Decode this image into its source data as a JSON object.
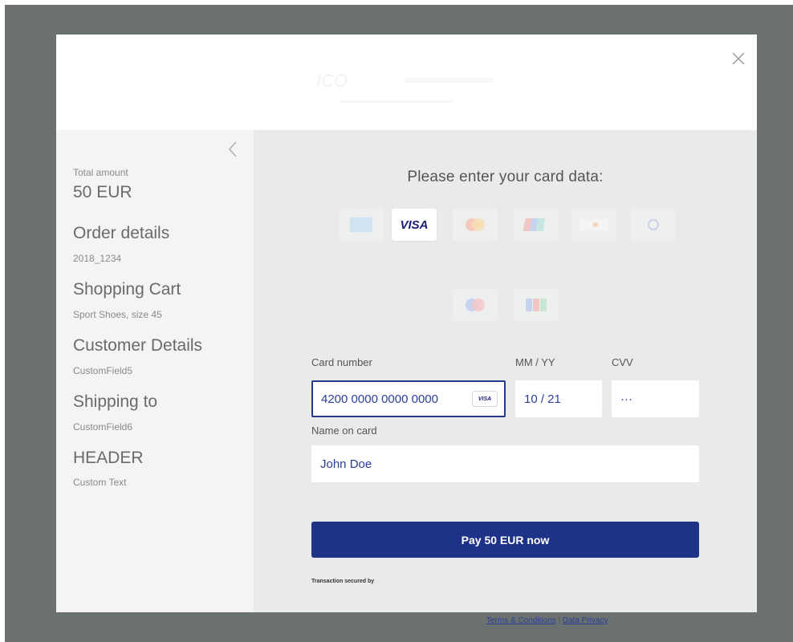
{
  "colors": {
    "backdrop": "#6a716f",
    "primary": "#1e3388",
    "input_text": "#2b3f96",
    "sidebar_bg": "#f4f4f4",
    "content_bg": "#e9ebea"
  },
  "header": {
    "close_icon": "close-icon"
  },
  "sidebar": {
    "back_icon": "chevron-left-icon",
    "total_amount_label": "Total amount",
    "total_amount_value": "50 EUR",
    "order_details_title": "Order details",
    "order_details_value": "2018_1234",
    "shopping_cart_title": "Shopping Cart",
    "shopping_cart_value": "Sport Shoes, size 45",
    "customer_details_title": "Customer Details",
    "customer_details_value": "CustomField5",
    "shipping_title": "Shipping to",
    "shipping_value": "CustomField6",
    "header_title": "HEADER",
    "header_value": "Custom Text"
  },
  "form": {
    "title": "Please enter your card data:",
    "card_brands": [
      "amex",
      "visa",
      "mastercard",
      "unionpay",
      "discover",
      "diners",
      "maestro",
      "jcb"
    ],
    "selected_brand": "visa",
    "selected_brand_label": "VISA",
    "card_number_label": "Card number",
    "card_number_value": "4200 0000 0000 0000",
    "card_badge": "VISA",
    "expiry_label": "MM / YY",
    "expiry_value": "10 / 21",
    "cvv_label": "CVV",
    "cvv_value": "···",
    "name_label": "Name on card",
    "name_value": "John Doe",
    "pay_button": "Pay 50 EUR now",
    "secured_text": "Transaction secured by",
    "terms_link": "Terms & Conditions",
    "separator": " | ",
    "privacy_link": "Data Privacy"
  }
}
